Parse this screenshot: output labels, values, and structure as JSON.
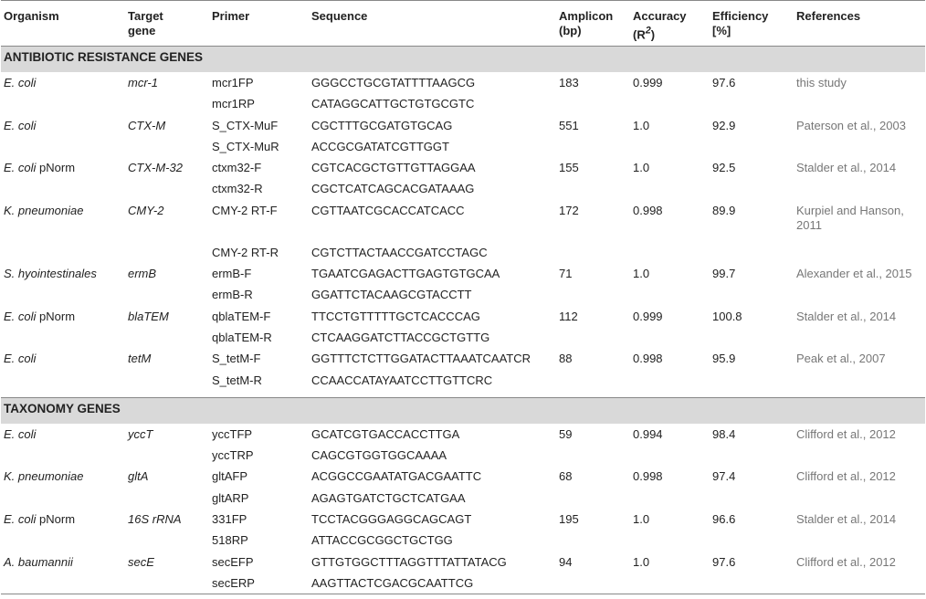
{
  "headers": {
    "organism": "Organism",
    "target_gene_1": "Target",
    "target_gene_2": "gene",
    "primer": "Primer",
    "sequence": "Sequence",
    "amplicon_1": "Amplicon",
    "amplicon_2": "(bp)",
    "accuracy_1": "Accuracy",
    "accuracy_2": "(R",
    "accuracy_sup": "2",
    "accuracy_3": ")",
    "efficiency_1": "Efficiency",
    "efficiency_2": "[%]",
    "references": "References"
  },
  "sections": [
    {
      "title": "ANTIBIOTIC RESISTANCE GENES",
      "groups": [
        {
          "org_italic": "E. coli",
          "org_suffix": "",
          "gene": "mcr-1",
          "amplicon": "183",
          "accuracy": "0.999",
          "efficiency": "97.6",
          "reference": "this study",
          "primers": [
            {
              "primer": "mcr1FP",
              "sequence": "GGGCCTGCGTATTTTAAGCG"
            },
            {
              "primer": "mcr1RP",
              "sequence": "CATAGGCATTGCTGTGCGTC"
            }
          ]
        },
        {
          "org_italic": "E. coli",
          "org_suffix": "",
          "gene": "CTX-M",
          "amplicon": "551",
          "accuracy": "1.0",
          "efficiency": "92.9",
          "reference": "Paterson et al., 2003",
          "primers": [
            {
              "primer": "S_CTX-MuF",
              "sequence": "CGCTTTGCGATGTGCAG"
            },
            {
              "primer": "S_CTX-MuR",
              "sequence": "ACCGCGATATCGTTGGT"
            }
          ]
        },
        {
          "org_italic": "E. coli",
          "org_suffix": " pNorm",
          "gene": "CTX-M-32",
          "amplicon": "155",
          "accuracy": "1.0",
          "efficiency": "92.5",
          "reference": "Stalder et al., 2014",
          "primers": [
            {
              "primer": "ctxm32-F",
              "sequence": "CGTCACGCTGTTGTTAGGAA"
            },
            {
              "primer": "ctxm32-R",
              "sequence": "CGCTCATCAGCACGATAAAG"
            }
          ]
        },
        {
          "org_italic": "K. pneumoniae",
          "org_suffix": "",
          "gene": "CMY-2",
          "amplicon": "172",
          "accuracy": "0.998",
          "efficiency": "89.9",
          "reference": "Kurpiel and Hanson, 2011",
          "primers": [
            {
              "primer": "CMY-2 RT-F",
              "sequence": "CGTTAATCGCACCATCACC"
            },
            {
              "primer": "CMY-2 RT-R",
              "sequence": "CGTCTTACTAACCGATCCTAGC"
            }
          ]
        },
        {
          "org_italic": "S. hyointestinales",
          "org_suffix": "",
          "gene": "ermB",
          "amplicon": "71",
          "accuracy": "1.0",
          "efficiency": "99.7",
          "reference": "Alexander et al., 2015",
          "primers": [
            {
              "primer": "ermB-F",
              "sequence": "TGAATCGAGACTTGAGTGTGCAA"
            },
            {
              "primer": "ermB-R",
              "sequence": "GGATTCTACAAGCGTACCTT"
            }
          ]
        },
        {
          "org_italic": "E. coli",
          "org_suffix": " pNorm",
          "gene": "blaTEM",
          "amplicon": "112",
          "accuracy": "0.999",
          "efficiency": "100.8",
          "reference": "Stalder et al., 2014",
          "primers": [
            {
              "primer": "qblaTEM-F",
              "sequence": "TTCCTGTTTTTGCTCACCCAG"
            },
            {
              "primer": "qblaTEM-R",
              "sequence": "CTCAAGGATCTTACCGCTGTTG"
            }
          ]
        },
        {
          "org_italic": "E. coli",
          "org_suffix": "",
          "gene": "tetM",
          "amplicon": "88",
          "accuracy": "0.998",
          "efficiency": "95.9",
          "reference": "Peak et al., 2007",
          "primers": [
            {
              "primer": "S_tetM-F",
              "sequence": "GGTTTCTCTTGGATACTTAAATCAATCR"
            },
            {
              "primer": "S_tetM-R",
              "sequence": "CCAACCATAYAATCCTTGTTCRC"
            }
          ]
        }
      ]
    },
    {
      "title": "TAXONOMY GENES",
      "groups": [
        {
          "org_italic": "E. coli",
          "org_suffix": "",
          "gene": "yccT",
          "amplicon": "59",
          "accuracy": "0.994",
          "efficiency": "98.4",
          "reference": "Clifford et al., 2012",
          "primers": [
            {
              "primer": "yccTFP",
              "sequence": "GCATCGTGACCACCTTGA"
            },
            {
              "primer": "yccTRP",
              "sequence": "CAGCGTGGTGGCAAAA"
            }
          ]
        },
        {
          "org_italic": "K. pneumoniae",
          "org_suffix": "",
          "gene": "gltA",
          "amplicon": "68",
          "accuracy": "0.998",
          "efficiency": "97.4",
          "reference": "Clifford et al., 2012",
          "primers": [
            {
              "primer": "gltAFP",
              "sequence": "ACGGCCGAATATGACGAATTC"
            },
            {
              "primer": "gltARP",
              "sequence": "AGAGTGATCTGCTCATGAA"
            }
          ]
        },
        {
          "org_italic": "E. coli",
          "org_suffix": " pNorm",
          "gene": "16S rRNA",
          "amplicon": "195",
          "accuracy": "1.0",
          "efficiency": "96.6",
          "reference": "Stalder et al., 2014",
          "primers": [
            {
              "primer": "331FP",
              "sequence": "TCCTACGGGAGGCAGCAGT"
            },
            {
              "primer": "518RP",
              "sequence": "ATTACCGCGGCTGCTGG"
            }
          ]
        },
        {
          "org_italic": "A. baumannii",
          "org_suffix": "",
          "gene": "secE",
          "amplicon": "94",
          "accuracy": "1.0",
          "efficiency": "97.6",
          "reference": "Clifford et al., 2012",
          "primers": [
            {
              "primer": "secEFP",
              "sequence": "GTTGTGGCTTTAGGTTTATTATACG"
            },
            {
              "primer": "secERP",
              "sequence": "AAGTTACTCGACGCAATTCG"
            }
          ]
        }
      ]
    }
  ]
}
